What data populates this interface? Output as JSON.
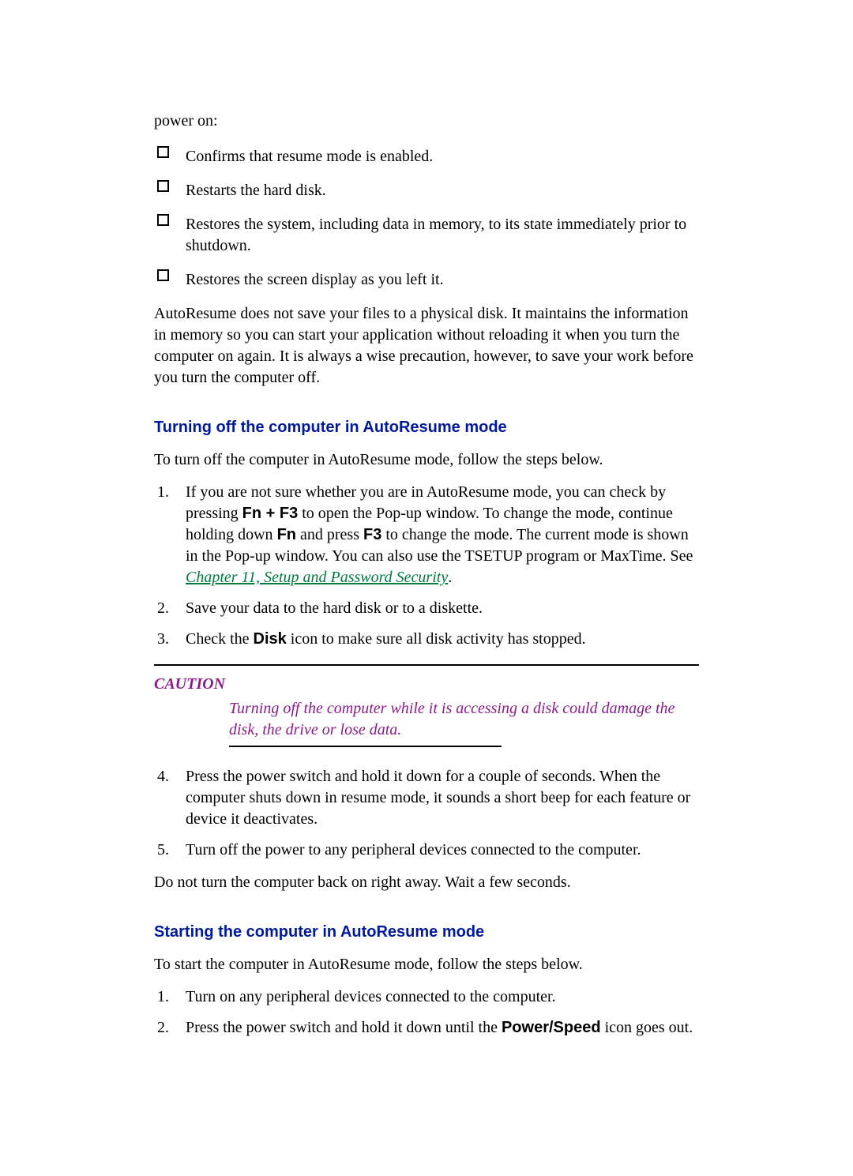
{
  "intro_line": "power on:",
  "checklist": [
    "Confirms that resume mode is enabled.",
    "Restarts the hard disk.",
    "Restores the system, including data in memory, to its state immediately prior to shutdown.",
    "Restores the screen display as you left it."
  ],
  "paragraph_after_checklist": "AutoResume does not save your files to a physical disk. It maintains the information in memory so you can start your application without reloading it when you turn the computer on again. It is always a wise precaution, however, to save your work before you turn the computer off.",
  "section1": {
    "title": "Turning off the computer in AutoResume mode",
    "intro": "To turn off the computer in AutoResume mode, follow the steps below.",
    "step1_a": "If you are not sure whether you are in AutoResume mode, you can check by pressing ",
    "step1_fnf3": "Fn + F3",
    "step1_b": " to open the Pop-up window. To change the mode, continue holding down ",
    "step1_fn": "Fn",
    "step1_c": " and press ",
    "step1_f3": "F3",
    "step1_d": " to change the mode. The current mode is shown in the Pop-up window. You can also use the TSETUP program or MaxTime. See ",
    "step1_link": "Chapter 11, Setup and Password Security",
    "step1_e": ".",
    "step2": "Save your data to the hard disk or to a diskette.",
    "step3_a": "Check the ",
    "step3_disk": "Disk",
    "step3_b": " icon to make sure all disk activity has stopped.",
    "caution_label": "CAUTION",
    "caution_text": "Turning off the computer while it is accessing a disk could damage the disk, the drive or lose data.",
    "step4": "Press the power switch and hold it down for a couple of seconds. When the computer shuts down in resume mode, it sounds a short beep for each feature or device it deactivates.",
    "step5": "Turn off the power to any peripheral devices connected to the computer.",
    "after": "Do not turn the computer back on right away. Wait a few seconds."
  },
  "section2": {
    "title": "Starting the computer in AutoResume mode",
    "intro": "To start the computer in AutoResume mode, follow the steps below.",
    "step1": "Turn on any peripheral devices connected to the computer.",
    "step2_a": "Press the power switch and hold it down until the ",
    "step2_ps": "Power/Speed",
    "step2_b": " icon goes out."
  }
}
